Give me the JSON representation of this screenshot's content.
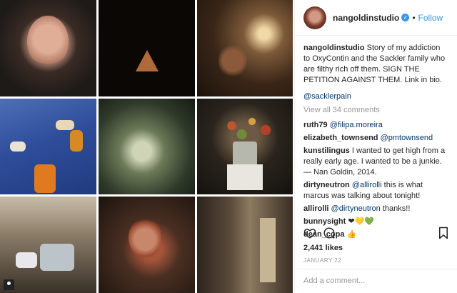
{
  "post": {
    "username": "nangoldinstudio",
    "follow_label": "Follow",
    "separator": "•",
    "caption": "Story of my addiction to OxyContin and the Sackler family who are filthy rich off them. SIGN THE PETITION AGAINST THEM. Link in bio.",
    "caption_tag": "@sacklerpain",
    "view_all": "View all 34 comments",
    "likes": "2,441 likes",
    "date": "JANUARY 22",
    "add_comment_placeholder": "Add a comment..."
  },
  "comments": [
    {
      "user": "ruth79",
      "mention": "@filipa.moreira",
      "text": ""
    },
    {
      "user": "elizabeth_townsend",
      "mention": "@pmtownsend",
      "text": ""
    },
    {
      "user": "kunstilingus",
      "mention": "",
      "text": "I wanted to get high from a really early age. I wanted to be a junkie. — Nan Goldin, 2014."
    },
    {
      "user": "dirtyneutron",
      "mention": "@allirolli",
      "text": "this is what marcus was talking about tonight!"
    },
    {
      "user": "allirolli",
      "mention": "@dirtyneutron",
      "text": "thanks!!"
    },
    {
      "user": "bunnysight",
      "mention": "",
      "text": ""
    },
    {
      "user": "dean_copa",
      "mention": "",
      "text": ""
    }
  ],
  "emoji": {
    "heart_black": "❤",
    "heart_yellow": "💛",
    "heart_green": "💚",
    "thumbs_up": "👍"
  },
  "colors": {
    "accent": "#3897f0",
    "text": "#262626",
    "muted": "#999999",
    "link": "#003569"
  },
  "icons": [
    "verified-badge-icon",
    "heart-icon",
    "comment-icon",
    "bookmark-icon",
    "multi-photo-icon"
  ]
}
